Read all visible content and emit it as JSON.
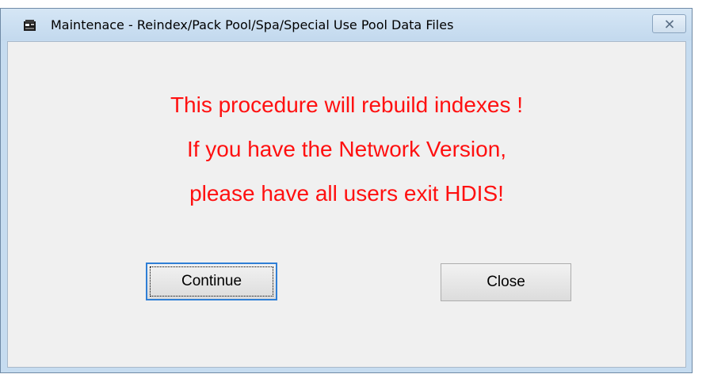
{
  "window": {
    "title": "Maintenace - Reindex/Pack Pool/Spa/Special Use Pool Data Files",
    "close_icon": "close-x-icon",
    "app_icon": "application-icon"
  },
  "message": {
    "line1": "This procedure will rebuild indexes !",
    "line2": "If you have the Network Version,",
    "line3": "please have all users exit HDIS!",
    "color": "#ff1010"
  },
  "buttons": {
    "continue_label": "Continue",
    "close_label": "Close"
  },
  "colors": {
    "title_bar": "#c6dcf0",
    "client_background": "#f0f0f0",
    "focus_border": "#2f7fd6"
  }
}
